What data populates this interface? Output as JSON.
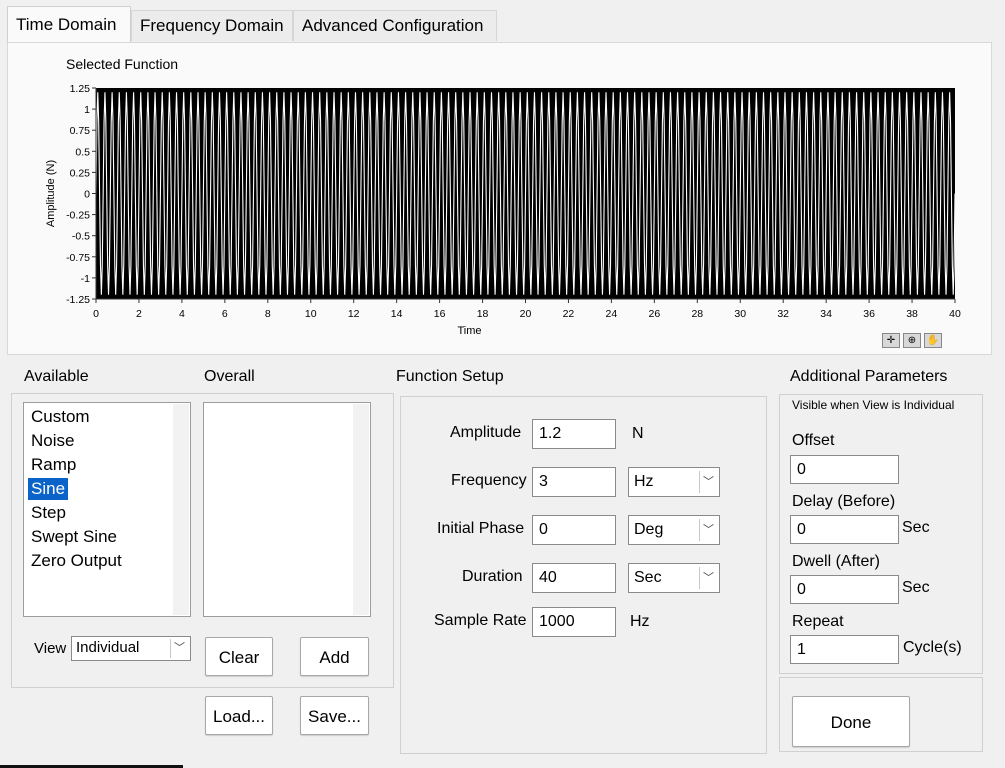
{
  "tabs": [
    {
      "label": "Time Domain",
      "active": true
    },
    {
      "label": "Frequency Domain",
      "active": false
    },
    {
      "label": "Advanced Configuration",
      "active": false
    }
  ],
  "graph": {
    "title": "Selected Function",
    "tool_icons": [
      "cursor-move-icon",
      "zoom-icon",
      "pan-hand-icon"
    ]
  },
  "chart_data": {
    "type": "line",
    "title": "Selected Function",
    "xlabel": "Time",
    "ylabel": "Amplitude (N)",
    "xlim": [
      0,
      40
    ],
    "ylim": [
      -1.25,
      1.25
    ],
    "x_ticks": [
      "0",
      "2",
      "4",
      "6",
      "8",
      "10",
      "12",
      "14",
      "16",
      "18",
      "20",
      "22",
      "24",
      "26",
      "28",
      "30",
      "32",
      "34",
      "36",
      "38",
      "40"
    ],
    "y_ticks": [
      "1.25",
      "1",
      "0.75",
      "0.5",
      "0.25",
      "0",
      "-0.25",
      "-0.5",
      "-0.75",
      "-1",
      "-1.25"
    ],
    "background": "#000000",
    "grid": false,
    "series": [
      {
        "function": "sine",
        "amplitude": 1.2,
        "frequency_hz": 3,
        "phase_deg": 0,
        "duration_s": 40,
        "color": "#ffffff"
      }
    ]
  },
  "available": {
    "label": "Available",
    "items": [
      "Custom",
      "Noise",
      "Ramp",
      "Sine",
      "Step",
      "Swept Sine",
      "Zero Output"
    ],
    "selected": "Sine"
  },
  "overall": {
    "label": "Overall",
    "items": []
  },
  "view": {
    "label": "View",
    "value": "Individual"
  },
  "buttons": {
    "clear": "Clear",
    "add": "Add",
    "load": "Load...",
    "save": "Save...",
    "done": "Done"
  },
  "function_setup": {
    "title": "Function Setup",
    "amplitude": {
      "label": "Amplitude",
      "value": "1.2",
      "unit": "N"
    },
    "frequency": {
      "label": "Frequency",
      "value": "3",
      "unit": "Hz"
    },
    "initial_phase": {
      "label": "Initial Phase",
      "value": "0",
      "unit": "Deg"
    },
    "duration": {
      "label": "Duration",
      "value": "40",
      "unit": "Sec"
    },
    "sample_rate": {
      "label": "Sample Rate",
      "value": "1000",
      "unit": "Hz"
    }
  },
  "additional": {
    "title": "Additional Parameters",
    "note": "Visible when View is Individual",
    "offset": {
      "label": "Offset",
      "value": "0"
    },
    "delay": {
      "label": "Delay (Before)",
      "value": "0",
      "unit": "Sec"
    },
    "dwell": {
      "label": "Dwell (After)",
      "value": "0",
      "unit": "Sec"
    },
    "repeat": {
      "label": "Repeat",
      "value": "1",
      "unit": "Cycle(s)"
    }
  },
  "colors": {
    "accent": "#0a63c9",
    "plot_bg": "#000000",
    "plot_line": "#ffffff",
    "panel_bg": "#f0f0f0"
  }
}
